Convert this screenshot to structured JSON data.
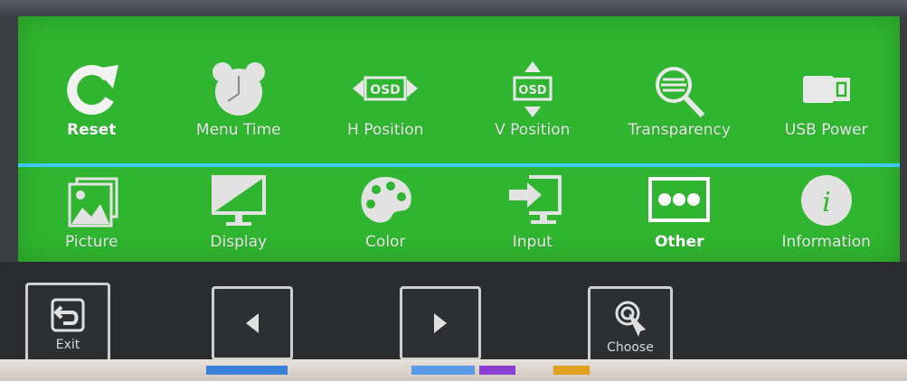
{
  "osd": {
    "top_items": [
      {
        "label": "Reset",
        "icon": "reset-icon"
      },
      {
        "label": "Menu Time",
        "icon": "alarm-clock-icon"
      },
      {
        "label": "H Position",
        "icon": "h-position-osd-icon"
      },
      {
        "label": "V Position",
        "icon": "v-position-osd-icon"
      },
      {
        "label": "Transparency",
        "icon": "transparency-icon"
      },
      {
        "label": "USB Power",
        "icon": "usb-icon"
      }
    ],
    "bottom_items": [
      {
        "label": "Picture",
        "icon": "picture-icon"
      },
      {
        "label": "Display",
        "icon": "display-icon"
      },
      {
        "label": "Color",
        "icon": "palette-icon"
      },
      {
        "label": "Input",
        "icon": "input-icon"
      },
      {
        "label": "Other",
        "icon": "other-icon",
        "selected": true
      },
      {
        "label": "Information",
        "icon": "information-icon"
      }
    ],
    "osd_badge_text": "OSD",
    "info_glyph": "i",
    "colors": {
      "menu_bg": "#2fb52f",
      "divider": "#3fc8ff",
      "text": "#e9e9e9"
    }
  },
  "controls": {
    "exit_label": "Exit",
    "choose_label": "Choose",
    "left_icon": "left-arrow-icon",
    "right_icon": "right-arrow-icon"
  }
}
